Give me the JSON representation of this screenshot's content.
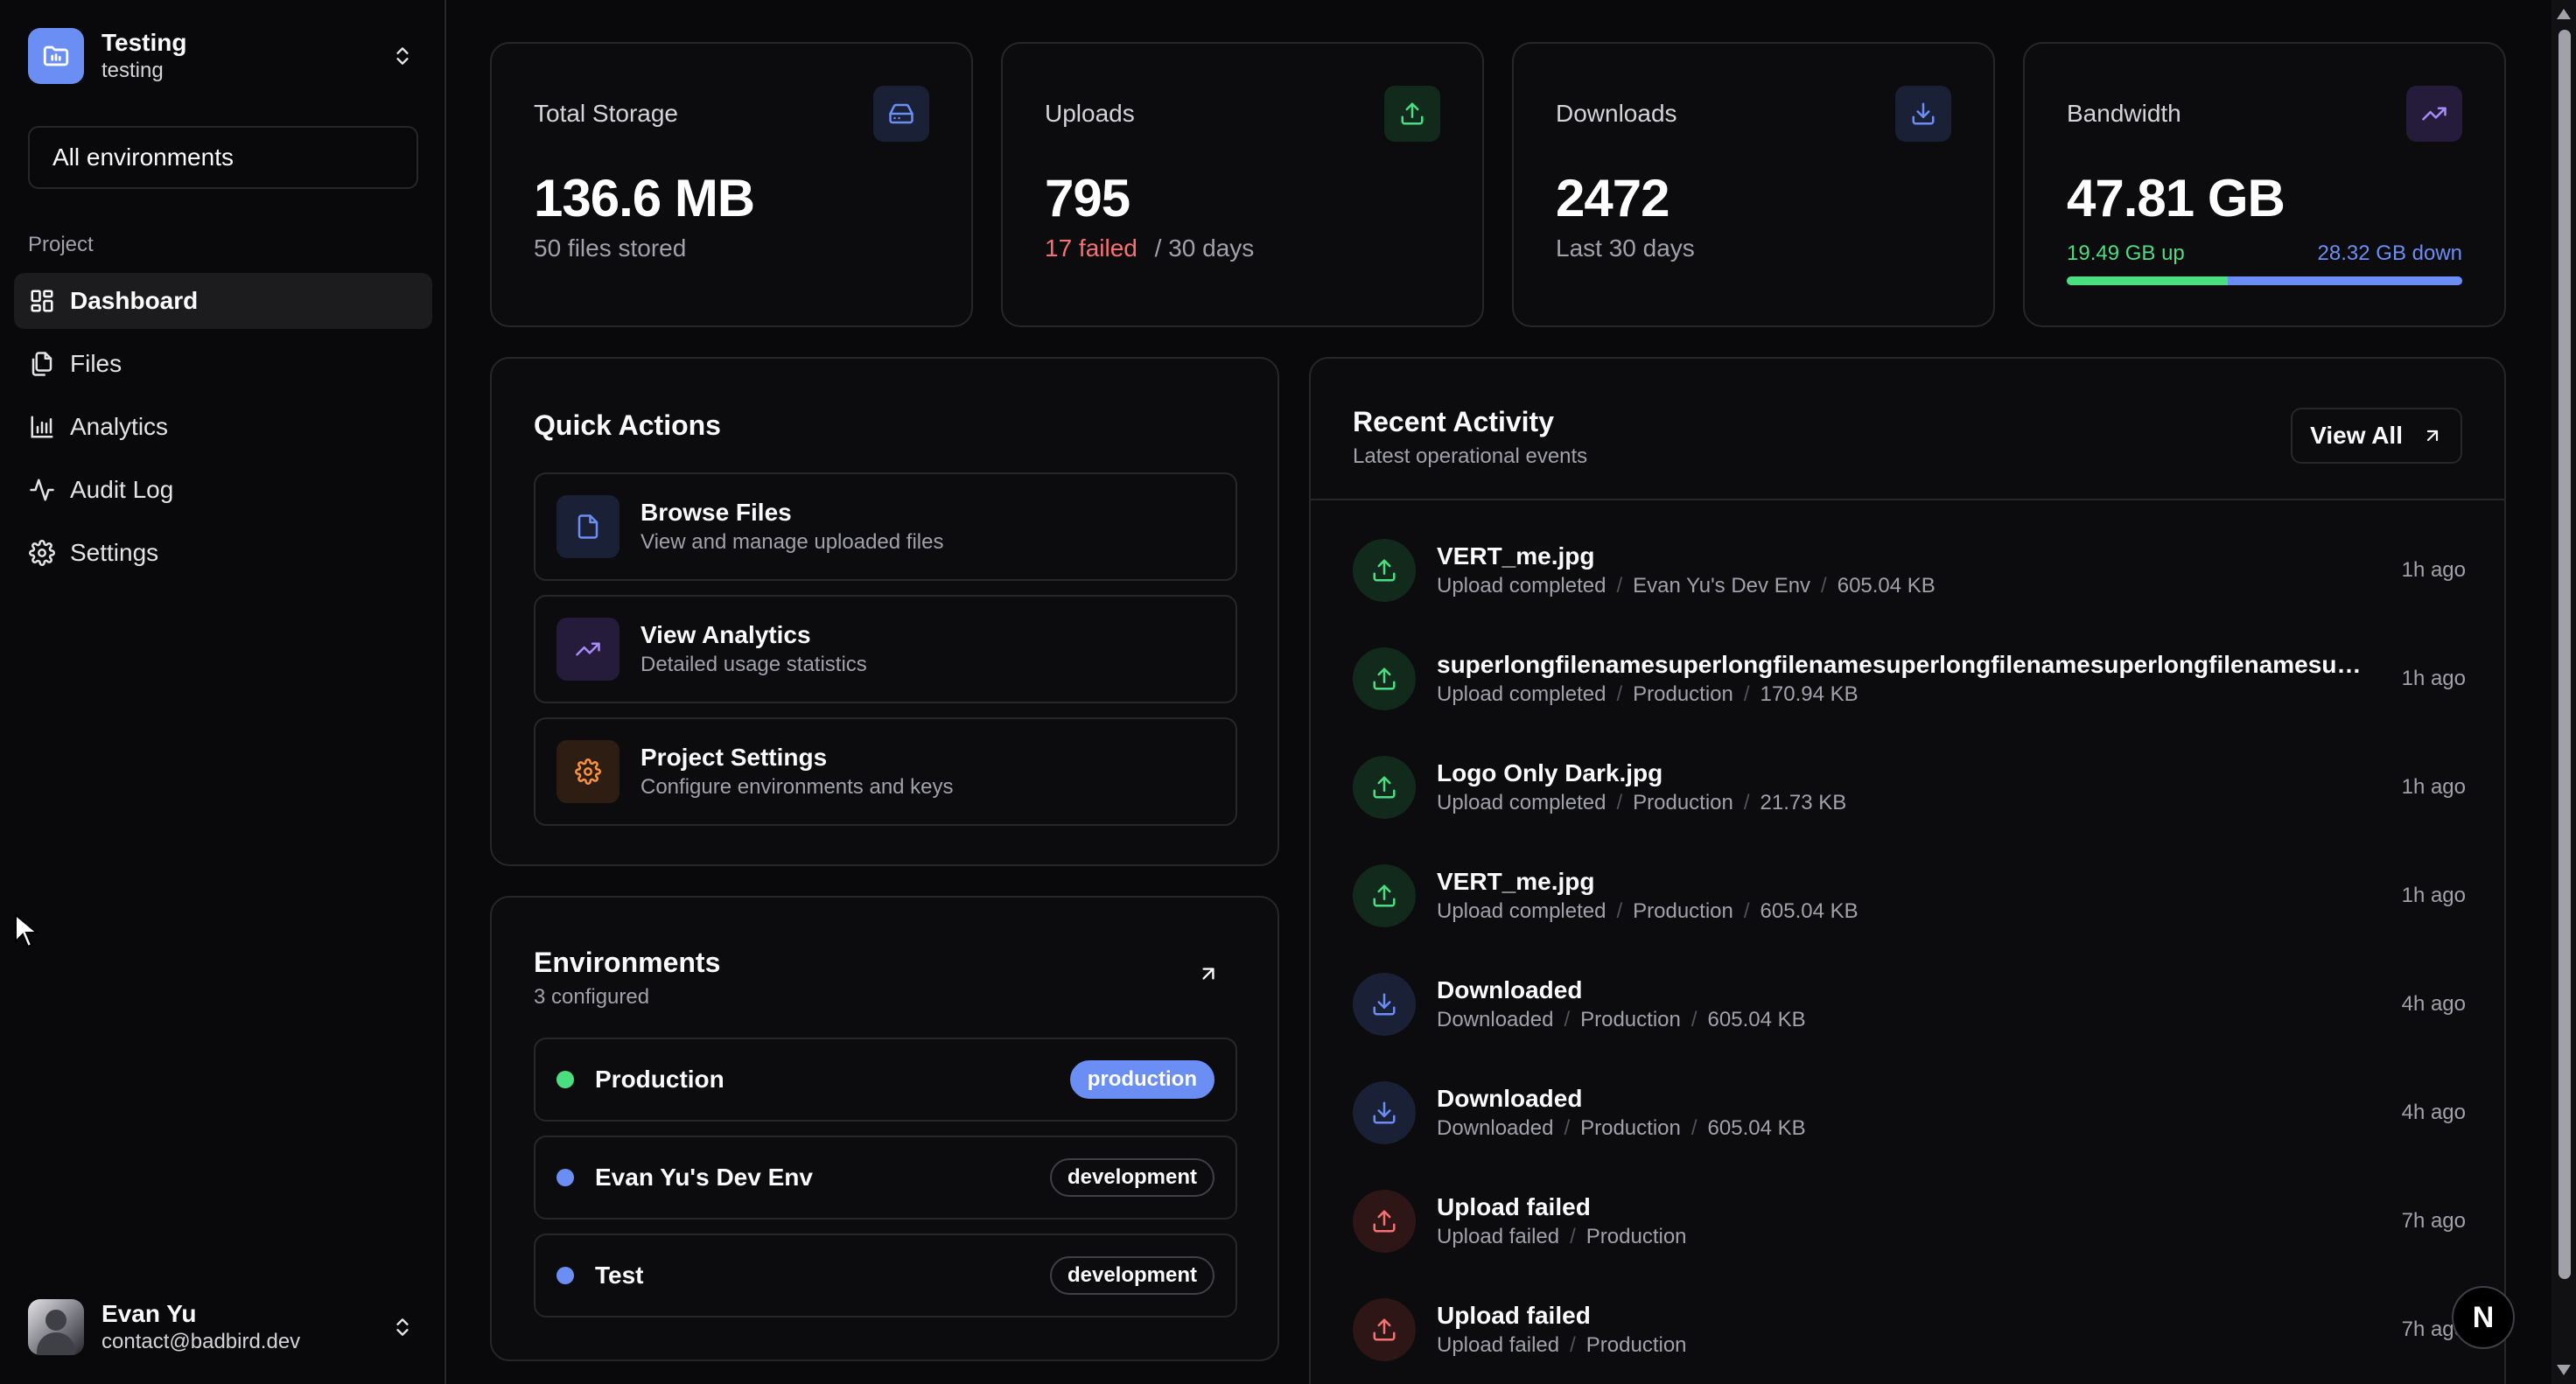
{
  "project": {
    "name": "Testing",
    "slug": "testing",
    "logo_icon": "folder-icon"
  },
  "environment_selector": {
    "value": "All environments"
  },
  "sidebar": {
    "group_label": "Project",
    "items": [
      {
        "label": "Dashboard",
        "icon": "dashboard-icon",
        "active": true
      },
      {
        "label": "Files",
        "icon": "files-icon"
      },
      {
        "label": "Analytics",
        "icon": "bar-chart-icon"
      },
      {
        "label": "Audit Log",
        "icon": "activity-icon"
      },
      {
        "label": "Settings",
        "icon": "gear-icon"
      }
    ]
  },
  "user": {
    "name": "Evan Yu",
    "email": "contact@badbird.dev"
  },
  "stats": {
    "storage": {
      "label": "Total Storage",
      "value": "136.6 MB",
      "sub": "50 files stored"
    },
    "uploads": {
      "label": "Uploads",
      "value": "795",
      "failed": "17 failed",
      "period": "/ 30 days"
    },
    "downloads": {
      "label": "Downloads",
      "value": "2472",
      "sub": "Last 30 days"
    },
    "bandwidth": {
      "label": "Bandwidth",
      "value": "47.81 GB",
      "up": "19.49 GB up",
      "down": "28.32 GB down",
      "up_fraction": 0.408
    }
  },
  "quick_actions": {
    "title": "Quick Actions",
    "items": [
      {
        "title": "Browse Files",
        "desc": "View and manage uploaded files",
        "icon": "file-icon"
      },
      {
        "title": "View Analytics",
        "desc": "Detailed usage statistics",
        "icon": "trending-up-icon"
      },
      {
        "title": "Project Settings",
        "desc": "Configure environments and keys",
        "icon": "gear-icon"
      }
    ]
  },
  "environments": {
    "title": "Environments",
    "sub": "3 configured",
    "items": [
      {
        "name": "Production",
        "badge": "production",
        "dot_color": "#4ade80"
      },
      {
        "name": "Evan Yu's Dev Env",
        "badge": "development",
        "dot_color": "#6b8ef5"
      },
      {
        "name": "Test",
        "badge": "development",
        "dot_color": "#6b8ef5"
      }
    ]
  },
  "recent_activity": {
    "title": "Recent Activity",
    "sub": "Latest operational events",
    "view_all": "View All",
    "items": [
      {
        "type": "upload",
        "title": "VERT_me.jpg",
        "meta": [
          "Upload completed",
          "Evan Yu's Dev Env",
          "605.04 KB"
        ],
        "time": "1h ago"
      },
      {
        "type": "upload",
        "title": "superlongfilenamesuperlongfilenamesuperlongfilenamesuperlongfilenamesuperlo...",
        "meta": [
          "Upload completed",
          "Production",
          "170.94 KB"
        ],
        "time": "1h ago"
      },
      {
        "type": "upload",
        "title": "Logo Only Dark.jpg",
        "meta": [
          "Upload completed",
          "Production",
          "21.73 KB"
        ],
        "time": "1h ago"
      },
      {
        "type": "upload",
        "title": "VERT_me.jpg",
        "meta": [
          "Upload completed",
          "Production",
          "605.04 KB"
        ],
        "time": "1h ago"
      },
      {
        "type": "download",
        "title": "Downloaded",
        "meta": [
          "Downloaded",
          "Production",
          "605.04 KB"
        ],
        "time": "4h ago"
      },
      {
        "type": "download",
        "title": "Downloaded",
        "meta": [
          "Downloaded",
          "Production",
          "605.04 KB"
        ],
        "time": "4h ago"
      },
      {
        "type": "failed",
        "title": "Upload failed",
        "meta": [
          "Upload failed",
          "Production"
        ],
        "time": "7h ago"
      },
      {
        "type": "failed",
        "title": "Upload failed",
        "meta": [
          "Upload failed",
          "Production"
        ],
        "time": "7h ago"
      }
    ]
  },
  "dev_badge": {
    "label": "N"
  },
  "colors": {
    "green": "#4ade80",
    "blue": "#6b8ef5",
    "red": "#f87171",
    "purple": "#a78bfa",
    "orange": "#fb923c"
  }
}
